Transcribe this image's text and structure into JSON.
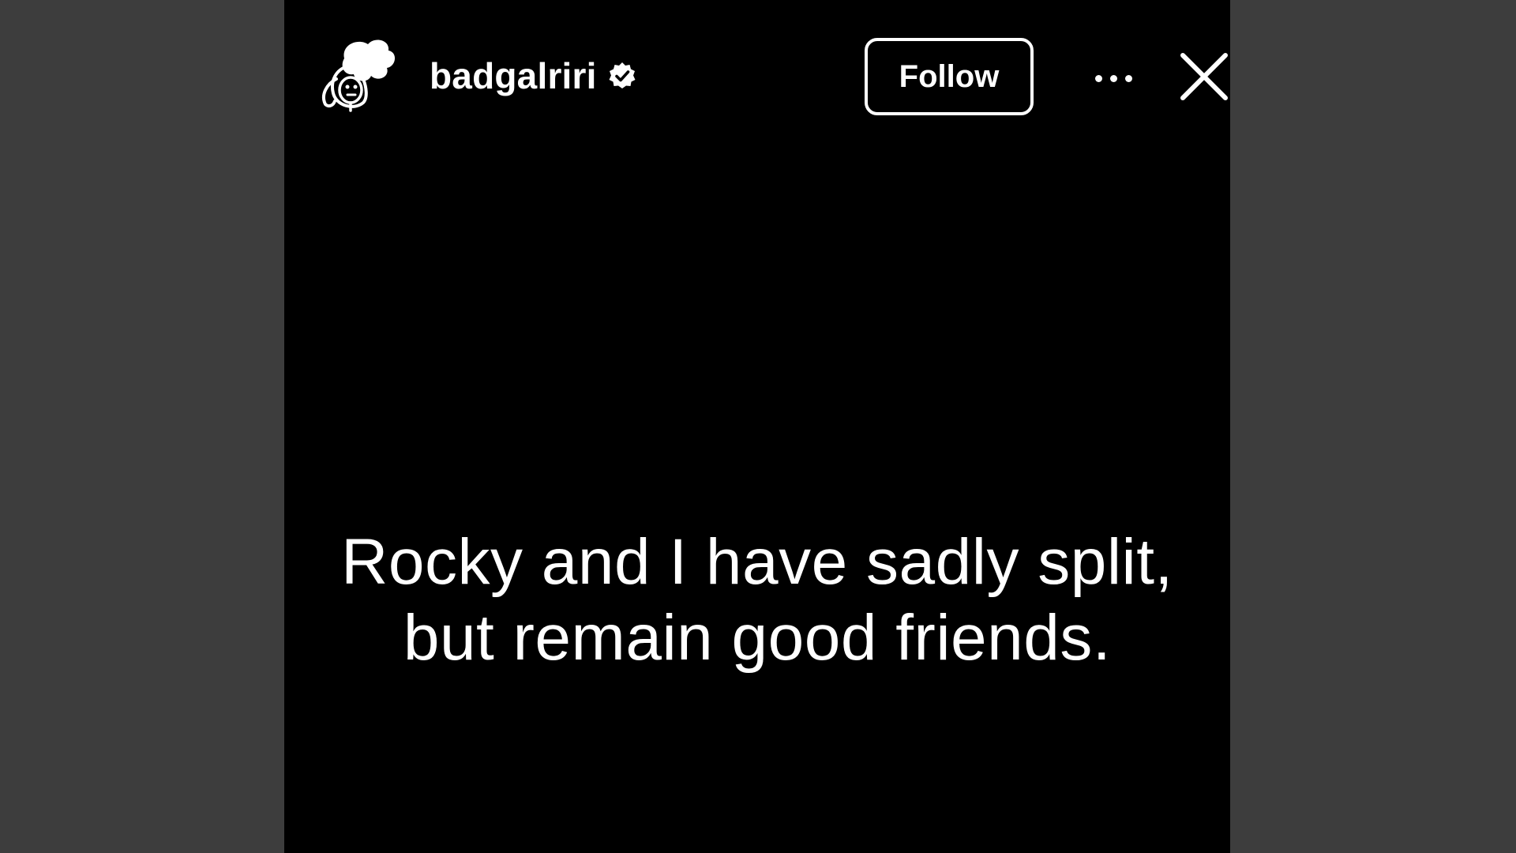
{
  "story": {
    "account": {
      "username": "badgalriri",
      "verified": true,
      "avatar_icon": "cartoon-avatar-icon",
      "verified_icon": "verified-badge-icon"
    },
    "actions": {
      "follow_label": "Follow",
      "more_icon": "more-options-icon",
      "close_icon": "close-icon"
    },
    "caption": {
      "line1": "Rocky and I have sadly split,",
      "line2": "but remain good friends."
    }
  },
  "colors": {
    "backdrop": "#3d3d3d",
    "story_background": "#000000",
    "foreground": "#ffffff"
  }
}
